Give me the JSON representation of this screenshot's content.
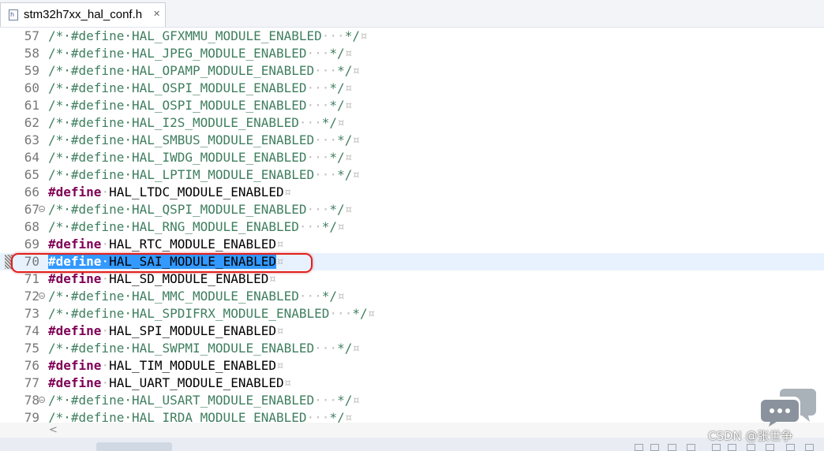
{
  "tab": {
    "title": "stm32h7xx_hal_conf.h",
    "close_glyph": "✕",
    "file_icon_letter": "h"
  },
  "code_lines": [
    {
      "num": "57",
      "fold": false,
      "type": "comment",
      "before": "/*",
      "define": "#define",
      "name": "HAL_GFXMMU_MODULE_ENABLED",
      "after": "*/",
      "eol": "¤"
    },
    {
      "num": "58",
      "fold": false,
      "type": "comment",
      "before": "/*",
      "define": "#define",
      "name": "HAL_JPEG_MODULE_ENABLED",
      "after": "*/",
      "eol": "¤"
    },
    {
      "num": "59",
      "fold": false,
      "type": "comment",
      "before": "/*",
      "define": "#define",
      "name": "HAL_OPAMP_MODULE_ENABLED",
      "after": "*/",
      "eol": "¤"
    },
    {
      "num": "60",
      "fold": false,
      "type": "comment",
      "before": "/*",
      "define": "#define",
      "name": "HAL_OSPI_MODULE_ENABLED",
      "after": "*/",
      "eol": "¤"
    },
    {
      "num": "61",
      "fold": false,
      "type": "comment",
      "before": "/*",
      "define": "#define",
      "name": "HAL_OSPI_MODULE_ENABLED",
      "after": "*/",
      "eol": "¤"
    },
    {
      "num": "62",
      "fold": false,
      "type": "comment",
      "before": "/*",
      "define": "#define",
      "name": "HAL_I2S_MODULE_ENABLED",
      "after": "*/",
      "eol": "¤"
    },
    {
      "num": "63",
      "fold": false,
      "type": "comment",
      "before": "/*",
      "define": "#define",
      "name": "HAL_SMBUS_MODULE_ENABLED",
      "after": "*/",
      "eol": "¤"
    },
    {
      "num": "64",
      "fold": false,
      "type": "comment",
      "before": "/*",
      "define": "#define",
      "name": "HAL_IWDG_MODULE_ENABLED",
      "after": "*/",
      "eol": "¤"
    },
    {
      "num": "65",
      "fold": false,
      "type": "comment",
      "before": "/*",
      "define": "#define",
      "name": "HAL_LPTIM_MODULE_ENABLED",
      "after": "*/",
      "eol": "¤"
    },
    {
      "num": "66",
      "fold": false,
      "type": "define",
      "define": "#define",
      "name": "HAL_LTDC_MODULE_ENABLED",
      "eol": "¤"
    },
    {
      "num": "67",
      "fold": true,
      "type": "comment",
      "before": "/*",
      "define": "#define",
      "name": "HAL_QSPI_MODULE_ENABLED",
      "after": "*/",
      "eol": "¤"
    },
    {
      "num": "68",
      "fold": false,
      "type": "comment",
      "before": "/*",
      "define": "#define",
      "name": "HAL_RNG_MODULE_ENABLED",
      "after": "*/",
      "eol": "¤"
    },
    {
      "num": "69",
      "fold": false,
      "type": "define",
      "define": "#define",
      "name": "HAL_RTC_MODULE_ENABLED",
      "eol": "¤"
    },
    {
      "num": "70",
      "fold": false,
      "type": "define",
      "define": "#define",
      "name": "HAL_SAI_MODULE_ENABLED",
      "eol": "¤",
      "selected": true,
      "current": true
    },
    {
      "num": "71",
      "fold": false,
      "type": "define",
      "define": "#define",
      "name": "HAL_SD_MODULE_ENABLED",
      "eol": "¤"
    },
    {
      "num": "72",
      "fold": true,
      "type": "comment",
      "before": "/*",
      "define": "#define",
      "name": "HAL_MMC_MODULE_ENABLED",
      "after": "*/",
      "eol": "¤"
    },
    {
      "num": "73",
      "fold": false,
      "type": "comment",
      "before": "/*",
      "define": "#define",
      "name": "HAL_SPDIFRX_MODULE_ENABLED",
      "after": "*/",
      "eol": "¤"
    },
    {
      "num": "74",
      "fold": false,
      "type": "define",
      "define": "#define",
      "name": "HAL_SPI_MODULE_ENABLED",
      "eol": "¤"
    },
    {
      "num": "75",
      "fold": false,
      "type": "comment",
      "before": "/*",
      "define": "#define",
      "name": "HAL_SWPMI_MODULE_ENABLED",
      "after": "*/",
      "eol": "¤"
    },
    {
      "num": "76",
      "fold": false,
      "type": "define",
      "define": "#define",
      "name": "HAL_TIM_MODULE_ENABLED",
      "eol": "¤"
    },
    {
      "num": "77",
      "fold": false,
      "type": "define",
      "define": "#define",
      "name": "HAL_UART_MODULE_ENABLED",
      "eol": "¤"
    },
    {
      "num": "78",
      "fold": true,
      "type": "comment",
      "before": "/*",
      "define": "#define",
      "name": "HAL_USART_MODULE_ENABLED",
      "after": "*/",
      "eol": "¤"
    },
    {
      "num": "79",
      "fold": false,
      "type": "comment",
      "before": "/*",
      "define": "#define",
      "name": "HAL_IRDA_MODULE_ENABLED",
      "after": "*/",
      "eol": "¤"
    }
  ],
  "scroll": {
    "left_arrow": "<"
  },
  "watermark": {
    "text": "CSDN @张世争"
  },
  "colors": {
    "comment": "#3f7f5f",
    "keyword": "#7f0055",
    "selection": "#3399ff",
    "current_line": "#e8f2fe",
    "ring": "#e02020"
  }
}
